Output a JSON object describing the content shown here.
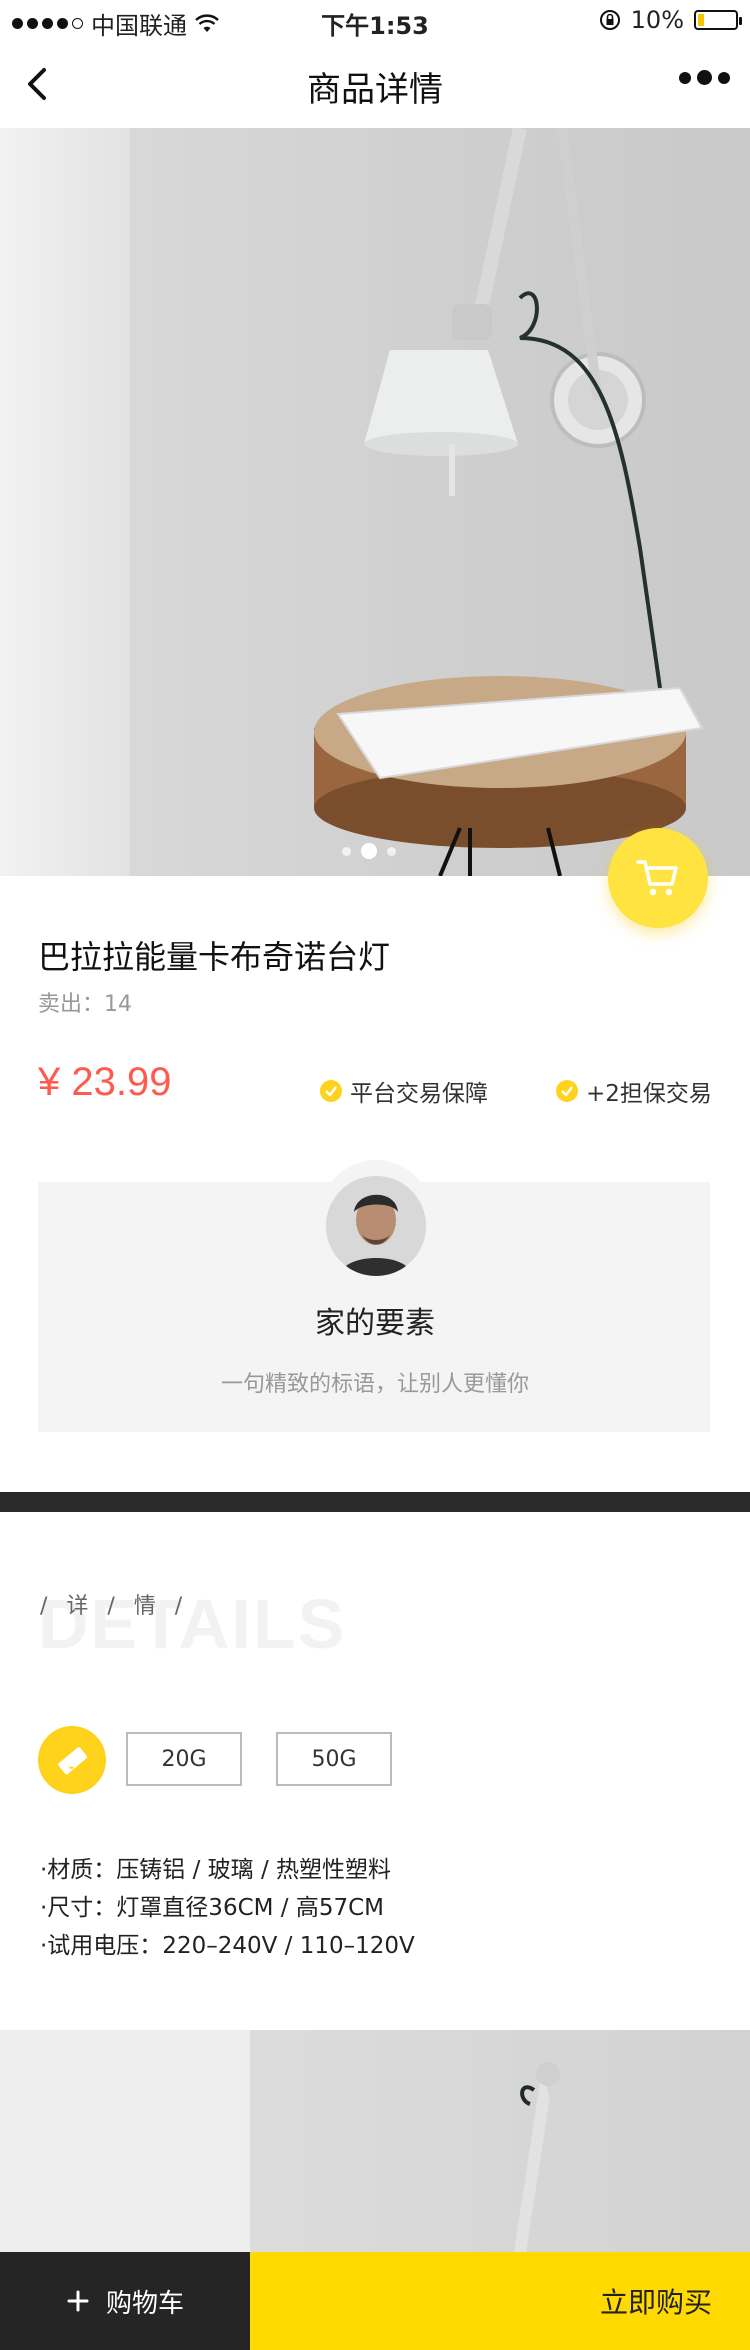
{
  "status_bar": {
    "carrier": "中国联通",
    "time": "下午1:53",
    "battery": "10%",
    "battery_level": 0.1
  },
  "nav": {
    "title": "商品详情",
    "back_icon": "back-chevron-icon",
    "more_icon": "more-dots-icon"
  },
  "gallery": {
    "total": 3,
    "active_index": 1
  },
  "product": {
    "title": "巴拉拉能量卡布奇诺台灯",
    "sold": "卖出：14",
    "price": "¥ 23.99",
    "guarantees": [
      "平台交易保障",
      "+2担保交易"
    ]
  },
  "brand": {
    "name": "家的要素",
    "slogan": "一句精致的标语，让别人更懂你"
  },
  "details": {
    "bg_word": "DETAILS",
    "label": "/ 详 / 情 /",
    "options": [
      "20G",
      "50G"
    ],
    "specs": [
      "·材质：压铸铝 / 玻璃 / 热塑性塑料",
      "·尺寸：灯罩直径36CM / 高57CM",
      "·试用电压：220–240V / 110–120V"
    ]
  },
  "bottom_bar": {
    "cart_label": "购物车",
    "buy_label": "立即购买"
  },
  "colors": {
    "accent": "#ffd900",
    "price": "#ff5a4e",
    "dark": "#252525"
  }
}
